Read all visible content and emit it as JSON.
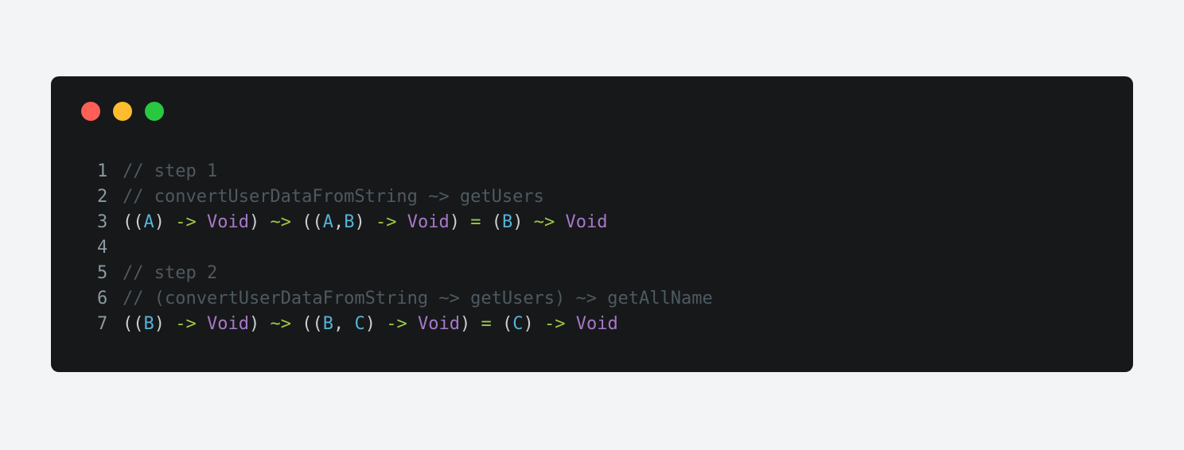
{
  "window": {
    "controls": [
      {
        "name": "close",
        "color": "#ff5f57"
      },
      {
        "name": "minimize",
        "color": "#febc2e"
      },
      {
        "name": "maximize",
        "color": "#28c840"
      }
    ]
  },
  "code": {
    "lines": [
      {
        "number": "1",
        "tokens": [
          {
            "t": "// step 1",
            "k": "comment"
          }
        ]
      },
      {
        "number": "2",
        "tokens": [
          {
            "t": "// convertUserDataFromString ~> getUsers",
            "k": "comment"
          }
        ]
      },
      {
        "number": "3",
        "tokens": [
          {
            "t": "((",
            "k": "punct"
          },
          {
            "t": "A",
            "k": "type"
          },
          {
            "t": ") ",
            "k": "punct"
          },
          {
            "t": "->",
            "k": "arrow"
          },
          {
            "t": " ",
            "k": "punct"
          },
          {
            "t": "Void",
            "k": "keyword"
          },
          {
            "t": ") ",
            "k": "punct"
          },
          {
            "t": "~>",
            "k": "arrow"
          },
          {
            "t": " ((",
            "k": "punct"
          },
          {
            "t": "A",
            "k": "type"
          },
          {
            "t": ",",
            "k": "punct"
          },
          {
            "t": "B",
            "k": "type"
          },
          {
            "t": ") ",
            "k": "punct"
          },
          {
            "t": "->",
            "k": "arrow"
          },
          {
            "t": " ",
            "k": "punct"
          },
          {
            "t": "Void",
            "k": "keyword"
          },
          {
            "t": ") ",
            "k": "punct"
          },
          {
            "t": "=",
            "k": "arrow"
          },
          {
            "t": " (",
            "k": "punct"
          },
          {
            "t": "B",
            "k": "type"
          },
          {
            "t": ") ",
            "k": "punct"
          },
          {
            "t": "~>",
            "k": "arrow"
          },
          {
            "t": " ",
            "k": "punct"
          },
          {
            "t": "Void",
            "k": "keyword"
          }
        ]
      },
      {
        "number": "4",
        "tokens": []
      },
      {
        "number": "5",
        "tokens": [
          {
            "t": "// step 2",
            "k": "comment"
          }
        ]
      },
      {
        "number": "6",
        "tokens": [
          {
            "t": "// (convertUserDataFromString ~> getUsers) ~> getAllName",
            "k": "comment"
          }
        ]
      },
      {
        "number": "7",
        "tokens": [
          {
            "t": "((",
            "k": "punct"
          },
          {
            "t": "B",
            "k": "type"
          },
          {
            "t": ") ",
            "k": "punct"
          },
          {
            "t": "->",
            "k": "arrow"
          },
          {
            "t": " ",
            "k": "punct"
          },
          {
            "t": "Void",
            "k": "keyword"
          },
          {
            "t": ") ",
            "k": "punct"
          },
          {
            "t": "~>",
            "k": "arrow"
          },
          {
            "t": " ((",
            "k": "punct"
          },
          {
            "t": "B",
            "k": "type"
          },
          {
            "t": ", ",
            "k": "punct"
          },
          {
            "t": "C",
            "k": "type"
          },
          {
            "t": ") ",
            "k": "punct"
          },
          {
            "t": "->",
            "k": "arrow"
          },
          {
            "t": " ",
            "k": "punct"
          },
          {
            "t": "Void",
            "k": "keyword"
          },
          {
            "t": ") ",
            "k": "punct"
          },
          {
            "t": "=",
            "k": "arrow"
          },
          {
            "t": " (",
            "k": "punct"
          },
          {
            "t": "C",
            "k": "type"
          },
          {
            "t": ") ",
            "k": "punct"
          },
          {
            "t": "->",
            "k": "arrow"
          },
          {
            "t": " ",
            "k": "punct"
          },
          {
            "t": "Void",
            "k": "keyword"
          }
        ]
      }
    ]
  }
}
